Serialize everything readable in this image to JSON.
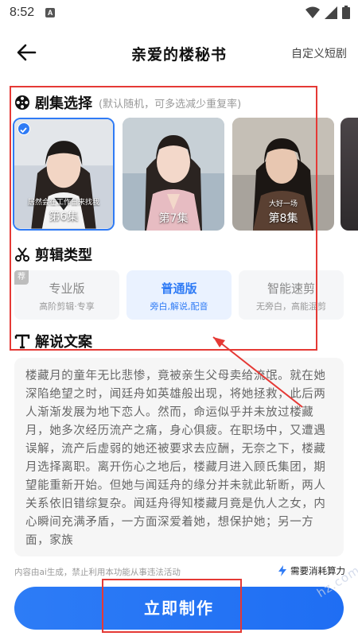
{
  "status_bar": {
    "time": "8:52",
    "notification_letter": "A"
  },
  "header": {
    "title": "亲爱的楼秘书",
    "custom_link": "自定义短剧"
  },
  "episodes": {
    "title": "剧集选择",
    "hint": "(默认随机，可多选减少重复率)",
    "items": [
      {
        "label": "第6集",
        "subtitle": "居然会在工作日来找我",
        "selected": true
      },
      {
        "label": "第7集",
        "subtitle": "",
        "selected": false
      },
      {
        "label": "第8集",
        "subtitle": "大好一场",
        "selected": false
      }
    ]
  },
  "edit_type": {
    "title": "剪辑类型",
    "options": [
      {
        "name": "专业版",
        "desc": "高阶剪辑·专享",
        "badge": "荐"
      },
      {
        "name": "普通版",
        "desc": "旁白,解说,配音",
        "active": true
      },
      {
        "name": "智能速剪",
        "desc": "无旁白，高能混剪"
      }
    ]
  },
  "script": {
    "title": "解说文案",
    "text": "楼藏月的童年无比悲惨，竟被亲生父母卖给流氓。就在她深陷绝望之时，闻廷舟如英雄般出现，将她拯救，此后两人渐渐发展为地下恋人。然而，命运似乎并未放过楼藏月，她多次经历流产之痛，身心俱疲。在职场中，又遭遇误解，流产后虚弱的她还被要求去应酬，无奈之下，楼藏月选择离职。离开伤心之地后，楼藏月进入顾氏集团，期望能重新开始。但她与闻廷舟的缘分并未就此斩断，两人关系依旧错综复杂。闻廷舟得知楼藏月竟是仇人之女，内心瞬间充满矛盾，一方面深爱着她，想保护她；另一方面，家族"
  },
  "footer": {
    "disclaimer": "内容由ai生成，禁止利用本功能从事违法活动",
    "power_note": "需要消耗算力",
    "make_button": "立即制作",
    "watermark": "hz.com"
  },
  "colors": {
    "accent": "#2f7bf5",
    "annotation": "#e53935"
  }
}
